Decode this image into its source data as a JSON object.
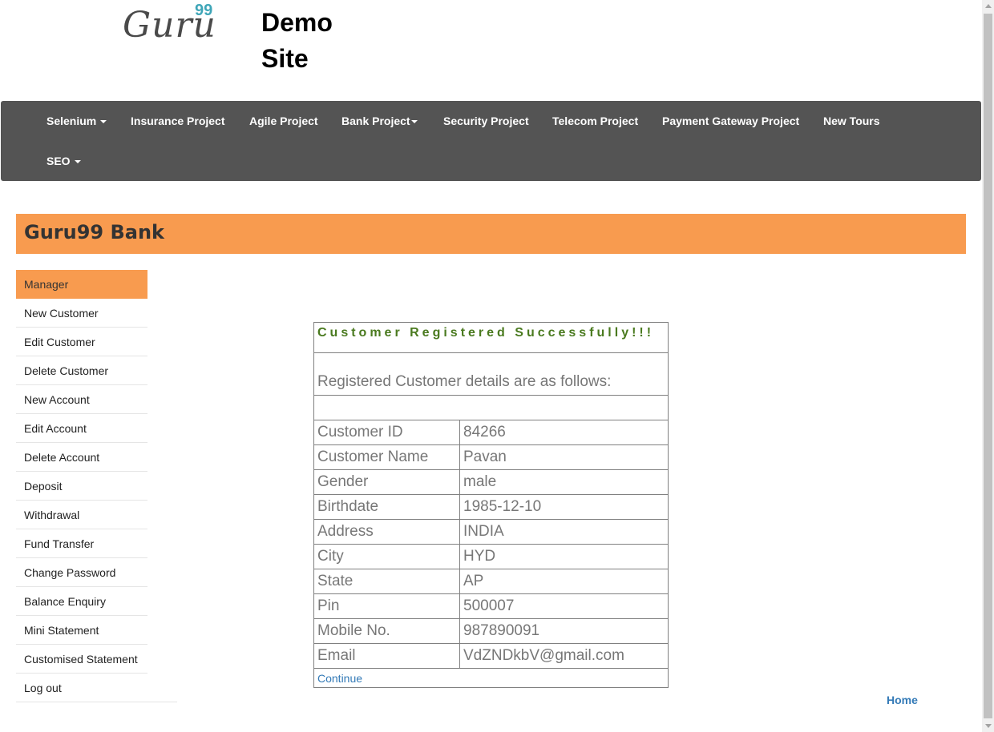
{
  "header": {
    "logo_word": "Guru",
    "logo_sup": "99",
    "site_title_line1": "Demo",
    "site_title_line2": "Site"
  },
  "navbar": {
    "items": [
      {
        "label": "Selenium",
        "dropdown": true
      },
      {
        "label": "Insurance Project",
        "dropdown": false
      },
      {
        "label": "Agile Project",
        "dropdown": false
      },
      {
        "label": "Bank Project",
        "dropdown": true
      },
      {
        "label": "Security Project",
        "dropdown": false
      },
      {
        "label": "Telecom Project",
        "dropdown": false
      },
      {
        "label": "Payment Gateway Project",
        "dropdown": false
      },
      {
        "label": "New Tours",
        "dropdown": false
      },
      {
        "label": "SEO",
        "dropdown": true
      }
    ]
  },
  "bank": {
    "title": "Guru99 Bank"
  },
  "sidebar": {
    "items": [
      {
        "label": "Manager"
      },
      {
        "label": "New Customer"
      },
      {
        "label": "Edit Customer"
      },
      {
        "label": "Delete Customer"
      },
      {
        "label": "New Account"
      },
      {
        "label": "Edit Account"
      },
      {
        "label": "Delete Account"
      },
      {
        "label": "Deposit"
      },
      {
        "label": "Withdrawal"
      },
      {
        "label": "Fund Transfer"
      },
      {
        "label": "Change Password"
      },
      {
        "label": "Balance Enquiry"
      },
      {
        "label": "Mini Statement"
      },
      {
        "label": "Customised Statement"
      },
      {
        "label": "Log out"
      }
    ]
  },
  "customer": {
    "success_message": "Customer Registered Successfully!!!",
    "details_heading": "Registered Customer details are as follows:",
    "rows": [
      {
        "label": "Customer ID",
        "value": "84266"
      },
      {
        "label": "Customer Name",
        "value": "Pavan"
      },
      {
        "label": "Gender",
        "value": "male"
      },
      {
        "label": "Birthdate",
        "value": "1985-12-10"
      },
      {
        "label": "Address",
        "value": "INDIA"
      },
      {
        "label": "City",
        "value": "HYD"
      },
      {
        "label": "State",
        "value": "AP"
      },
      {
        "label": "Pin",
        "value": "500007"
      },
      {
        "label": "Mobile No.",
        "value": "987890091"
      },
      {
        "label": "Email",
        "value": "VdZNDkbV@gmail.com"
      }
    ],
    "continue_label": "Continue"
  },
  "footer": {
    "home_label": "Home"
  },
  "colors": {
    "navbar_bg": "#545454",
    "accent_orange": "#f89b4f",
    "success_green": "#4a7a1f",
    "link_blue": "#337ab7",
    "logo_teal": "#3fa6b8"
  }
}
